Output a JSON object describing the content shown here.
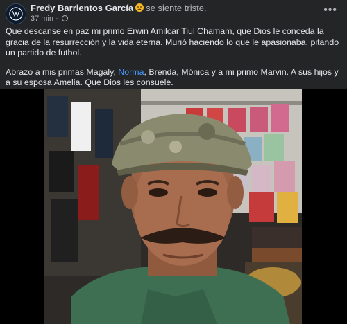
{
  "post": {
    "author": "Fredy Barrientos García",
    "feeling": "se siente triste.",
    "time": "37 min",
    "dot": "·",
    "privacy_icon": "globe-icon",
    "more_icon": "more-options-icon",
    "paragraph1": "Que descanse en paz mi primo Erwin Amilcar Tiul Chamam, que Dios le conceda la gracia de la resurrección y la vida eterna. Murió haciendo lo que le apasionaba, pitando un partido de futbol.",
    "paragraph2_before": "Abrazo a mis primas Magaly, ",
    "mention": "Norma",
    "paragraph2_after": ", Brenda, Mónica y a mi primo Marvin. A sus hijos y a su esposa Amelia. Que Dios les consuele."
  },
  "colors": {
    "background": "#242526",
    "text": "#e4e6eb",
    "secondary": "#b0b3b8",
    "mention": "#4599ff",
    "emoji": "#f7b928"
  }
}
